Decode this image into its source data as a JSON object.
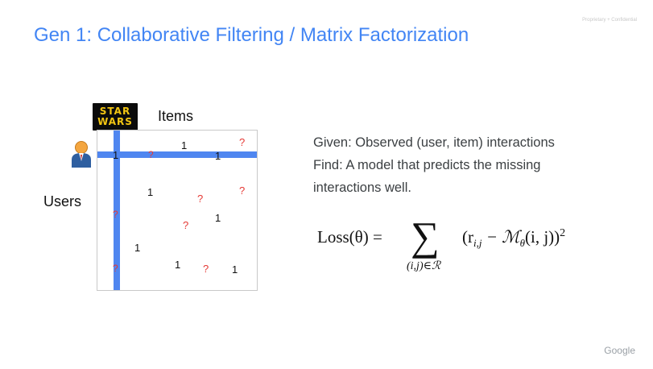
{
  "header": {
    "title": "Gen 1: Collaborative Filtering / Matrix Factorization",
    "confidential": "Proprietary + Confidential"
  },
  "diagram": {
    "items_label": "Items",
    "users_label": "Users",
    "logo_lines": [
      "STAR",
      "WARS"
    ],
    "highlight_color": "#4f86f0",
    "known_color": "#111111",
    "missing_color": "#e53935",
    "cells": {
      "c1": "1",
      "c2": "?",
      "c3": "1",
      "c4": "?",
      "c5": "1",
      "c6": "1",
      "c7": "?",
      "c8": "?",
      "c9": "?",
      "c10": "?",
      "c11": "1",
      "c12": "1",
      "c13": "?",
      "c14": "1",
      "c15": "?",
      "c16": "1"
    },
    "icons": [
      "star-wars-logo-icon",
      "user-avatar-icon"
    ]
  },
  "description": {
    "given": "Given: Observed (user, item) interactions",
    "find_line1": "Find: A model that predicts the missing",
    "find_line2": "interactions well."
  },
  "formula": {
    "lhs": "Loss(θ) =",
    "sum_symbol": "∑",
    "sum_subscript": "(i,j)∈ℛ",
    "rhs_main": "(r",
    "rhs_sub1": "i,j",
    "rhs_mid": " − ℳ",
    "rhs_sub2": "θ",
    "rhs_args": "(i, j))",
    "rhs_power": "2"
  },
  "footer": {
    "brand": "Google"
  }
}
